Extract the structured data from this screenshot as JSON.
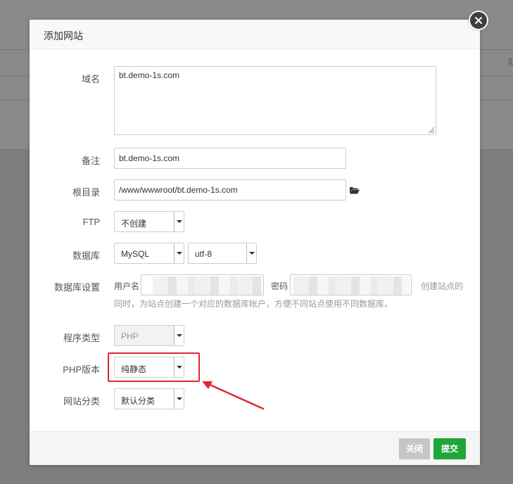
{
  "background": {
    "edge_text": "队"
  },
  "dialog": {
    "title": "添加网站",
    "close_icon": "close-icon"
  },
  "form": {
    "domain": {
      "label": "域名",
      "value": "bt.demo-1s.com"
    },
    "remark": {
      "label": "备注",
      "value": "bt.demo-1s.com"
    },
    "root": {
      "label": "根目录",
      "value": "/www/wwwroot/bt.demo-1s.com",
      "icon": "folder-open-icon"
    },
    "ftp": {
      "label": "FTP",
      "selected": "不创建"
    },
    "database": {
      "label": "数据库",
      "selected": "MySQL",
      "charset": "utf-8"
    },
    "db_settings": {
      "label": "数据库设置",
      "user_label": "用户名",
      "password_label": "密码",
      "hint_line1": "创建站点的",
      "hint_line2": "同时，为站点创建一个对应的数据库帐户，方便不同站点使用不同数据库。"
    },
    "program_type": {
      "label": "程序类型",
      "selected": "PHP"
    },
    "php_version": {
      "label": "PHP版本",
      "selected": "纯静态"
    },
    "site_category": {
      "label": "网站分类",
      "selected": "默认分类"
    }
  },
  "footer": {
    "close_label": "关闭",
    "submit_label": "提交"
  },
  "colors": {
    "accent_green": "#20a53a",
    "highlight_red": "#e3262e",
    "disabled_gray": "#c6c6c6"
  }
}
